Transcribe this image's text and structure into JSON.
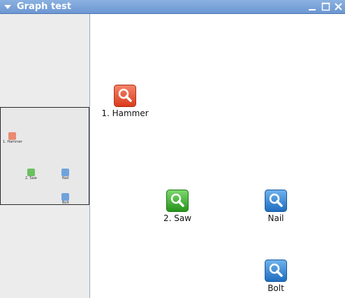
{
  "window": {
    "title": "Graph test"
  },
  "colors": {
    "titlebar": "#7aa3da",
    "hammer_node": "#e4532f",
    "saw_node": "#3aa82e",
    "nail_node": "#2f7fcf",
    "bolt_node": "#2f7fcf"
  },
  "nodes": [
    {
      "id": "hammer",
      "label": "1. Hammer",
      "icon": "search-icon",
      "color": "#e4532f"
    },
    {
      "id": "saw",
      "label": "2. Saw",
      "icon": "search-icon",
      "color": "#3aa82e"
    },
    {
      "id": "nail",
      "label": "Nail",
      "icon": "search-icon",
      "color": "#2f7fcf"
    },
    {
      "id": "bolt",
      "label": "Bolt",
      "icon": "search-icon",
      "color": "#2f7fcf"
    }
  ]
}
